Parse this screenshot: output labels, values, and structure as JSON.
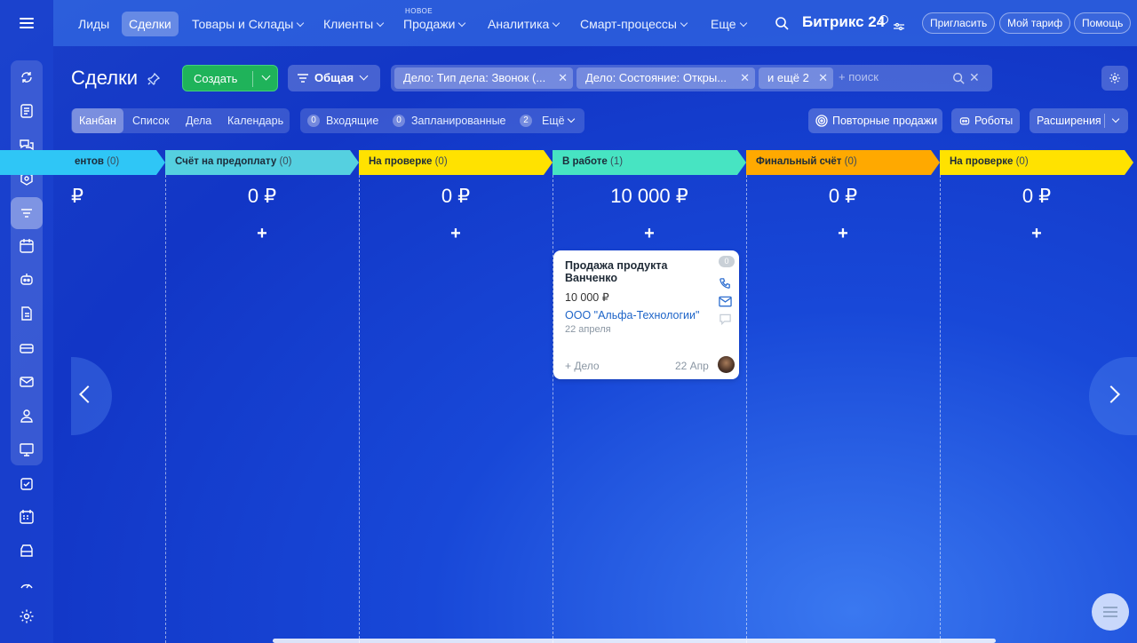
{
  "topnav": {
    "items": [
      {
        "label": "Лиды"
      },
      {
        "label": "Сделки"
      },
      {
        "label": "Товары и Склады"
      },
      {
        "label": "Клиенты"
      },
      {
        "label": "Продажи"
      },
      {
        "label": "Аналитика"
      },
      {
        "label": "Смарт-процессы"
      },
      {
        "label": "Еще"
      }
    ],
    "new_badge": "НОВОЕ",
    "brand": "Битрикс 24",
    "invite_label": "Пригласить",
    "tariff_label": "Мой тариф",
    "help_label": "Помощь"
  },
  "page": {
    "title": "Сделки",
    "create_label": "Создать",
    "pipeline_label": "Общая"
  },
  "filter": {
    "chips": [
      "Дело: Тип дела: Звонок (...",
      "Дело: Состояние: Откры...",
      "и ещё 2"
    ],
    "search_placeholder": "+ поиск"
  },
  "views": {
    "items": [
      "Канбан",
      "Список",
      "Дела",
      "Календарь"
    ],
    "active": "Канбан"
  },
  "counters": [
    {
      "count": "0",
      "label": "Входящие"
    },
    {
      "count": "0",
      "label": "Запланированные"
    },
    {
      "count": "2",
      "label": "Ещё"
    }
  ],
  "toolbar_right": {
    "repeat_sales": "Повторные продажи",
    "robots": "Роботы",
    "extensions": "Расширения"
  },
  "stages": [
    {
      "name": "ентов",
      "count": "(0)",
      "sum": "₽",
      "color": "#2fc6f6"
    },
    {
      "name": "Счёт на предоплату",
      "count": "(0)",
      "sum": "0 ₽",
      "color": "#55d0e0"
    },
    {
      "name": "На проверке",
      "count": "(0)",
      "sum": "0 ₽",
      "color": "#ffe200"
    },
    {
      "name": "В работе",
      "count": "(1)",
      "sum": "10 000 ₽",
      "color": "#47e4c2"
    },
    {
      "name": "Финальный счёт",
      "count": "(0)",
      "sum": "0 ₽",
      "color": "#ffa900"
    },
    {
      "name": "На проверке",
      "count": "(0)",
      "sum": "0 ₽",
      "color": "#ffe200"
    }
  ],
  "card": {
    "title": "Продажа продукта Ванченко",
    "price": "10 000 ₽",
    "company": "ООО \"Альфа-Технологии\"",
    "date": "22 апреля",
    "activity_counter": "0",
    "add_activity": "+ Дело",
    "short_date": "22 Апр"
  }
}
